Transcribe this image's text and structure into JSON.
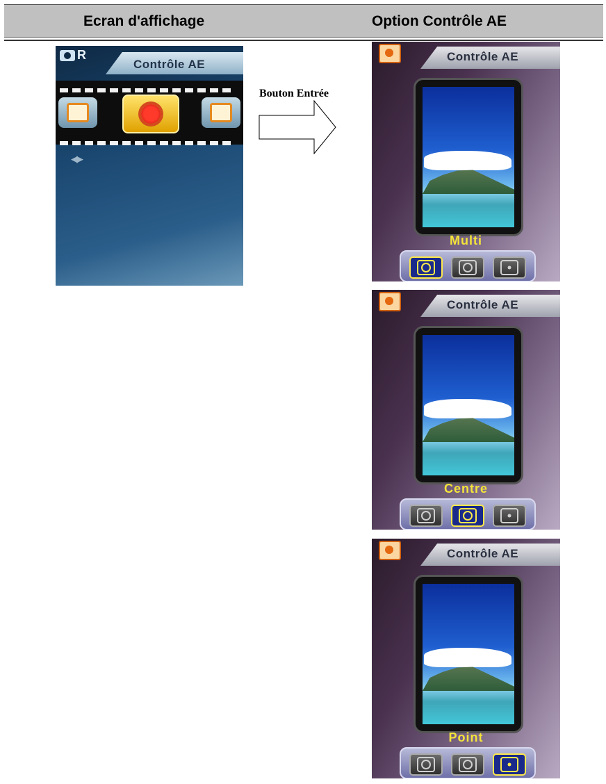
{
  "header": {
    "left": "Ecran d'affichage",
    "right": "Option Contrôle AE"
  },
  "left_screen": {
    "mode_letter": "R",
    "title": "Contrôle AE",
    "nav_hint": "◀▶"
  },
  "arrow_label": "Bouton Entrée",
  "right_screens": [
    {
      "title": "Contrôle AE",
      "mode": "Multi",
      "selected_index": 0
    },
    {
      "title": "Contrôle AE",
      "mode": "Centre",
      "selected_index": 1
    },
    {
      "title": "Contrôle AE",
      "mode": "Point",
      "selected_index": 2
    }
  ]
}
